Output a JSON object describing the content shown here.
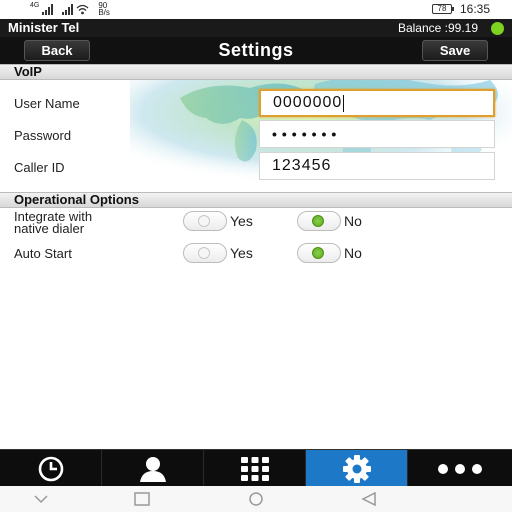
{
  "status_bar": {
    "signal_tag": "4G",
    "speed_top": "90",
    "speed_bottom": "B/s",
    "battery": "78",
    "time": "16:35"
  },
  "app_bar": {
    "app_name": "Minister Tel",
    "balance": "Balance :99.19",
    "status_color": "#7ed321"
  },
  "nav": {
    "back_label": "Back",
    "title": "Settings",
    "save_label": "Save"
  },
  "voip": {
    "header": "VoIP",
    "fields": [
      {
        "label": "User Name",
        "value": "0000000",
        "focused": true
      },
      {
        "label": "Password",
        "value": "•••••••"
      },
      {
        "label": "Caller ID",
        "value": "123456"
      }
    ]
  },
  "options": {
    "header": "Operational Options",
    "items": [
      {
        "label_line1": "Integrate with",
        "label_line2": "native dialer",
        "yes_label": "Yes",
        "no_label": "No",
        "selected": "No"
      },
      {
        "label_line1": "Auto Start",
        "label_line2": "",
        "yes_label": "Yes",
        "no_label": "No",
        "selected": "No"
      }
    ]
  },
  "tabs": [
    {
      "icon": "clock-icon",
      "name": "recents"
    },
    {
      "icon": "contact-icon",
      "name": "contacts"
    },
    {
      "icon": "dialpad-icon",
      "name": "dialpad"
    },
    {
      "icon": "gear-icon",
      "name": "settings",
      "active": true
    },
    {
      "icon": "more-icon",
      "name": "more"
    }
  ],
  "colors": {
    "accent_tab": "#1e78c8",
    "radio_on": "#6bbd2a",
    "focus_border": "#e0a030"
  }
}
